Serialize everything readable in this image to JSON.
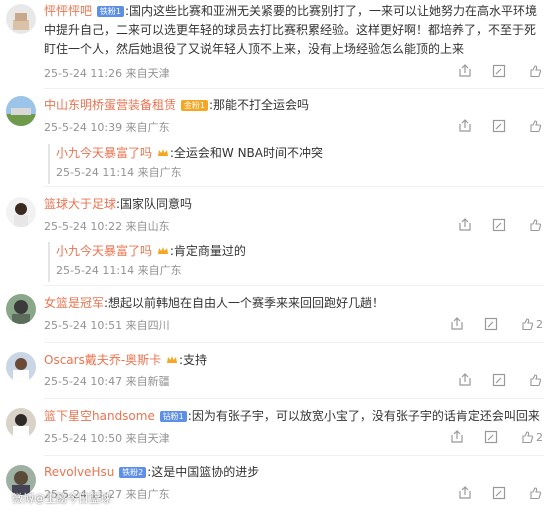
{
  "comments": [
    {
      "username": "怦怦怦吧",
      "badge": "铁粉1",
      "badge_kind": "fan",
      "text": ":国内这些比赛和亚洲无关紧要的比赛别打了，一来可以让她努力在高水平环境中提升自己，二来可以选更年轻的球员去打比赛积累经验。这样更好啊！都培养了，不至于死盯住一个人，然后她退役了又说年轻人顶不上来，没有上场经验怎么能顶的上来",
      "meta": "25-5-24 11:26 来自天津",
      "likes": "",
      "avatar": "avatar-1"
    },
    {
      "username": "中山东明桥蛋营装备租赁",
      "badge": "金粉1",
      "badge_kind": "gold",
      "text": ":那能不打全运会吗",
      "meta": "25-5-24 10:39 来自广东",
      "likes": "",
      "avatar": "avatar-2",
      "reply": {
        "username": "小九今天暴富了吗",
        "text": ":全运会和W NBA时间不冲突",
        "meta": "25-5-24 11:14 来自广东"
      }
    },
    {
      "username": "篮球大于足球",
      "badge": "",
      "badge_kind": "",
      "text": ":国家队同意吗",
      "meta": "25-5-24 10:22 来自山东",
      "likes": "",
      "avatar": "avatar-3",
      "reply": {
        "username": "小九今天暴富了吗",
        "text": ":肯定商量过的",
        "meta": "25-5-24 11:14 来自广东"
      }
    },
    {
      "username": "女篮是冠军",
      "badge": "",
      "badge_kind": "",
      "text": ":想起以前韩旭在自由人一个赛季来来回回跑好几趟！",
      "meta": "25-5-24 10:51 来自四川",
      "likes": "2",
      "avatar": "avatar-4"
    },
    {
      "username": "Oscars戴夫乔-奥斯卡",
      "badge": "",
      "badge_kind": "crown",
      "text": ":支持",
      "meta": "25-5-24 10:47 来自新疆",
      "likes": "",
      "avatar": "avatar-5"
    },
    {
      "username": "篮下星空handsome",
      "badge": "钻粉1",
      "badge_kind": "fan",
      "text": ":因为有张子宇，可以放宽小宝了，没有张子宇的话肯定还会叫回来",
      "meta": "25-5-24 10:50 来自天津",
      "likes": "2",
      "avatar": "avatar-6"
    },
    {
      "username": "RevolveHsu",
      "badge": "铁粉2",
      "badge_kind": "fan",
      "text": ":这是中国篮协的进步",
      "meta": "25-5-24 11:27 来自广东",
      "likes": "",
      "avatar": "avatar-7"
    }
  ],
  "watermark": "微博@王懿今日篮球",
  "colors": {
    "username": "#eb7350",
    "meta": "#939393",
    "badge_fan": "#5d8fe6",
    "badge_gold": "#f5a623"
  },
  "icons": [
    "share-icon",
    "comment-icon",
    "like-icon"
  ]
}
